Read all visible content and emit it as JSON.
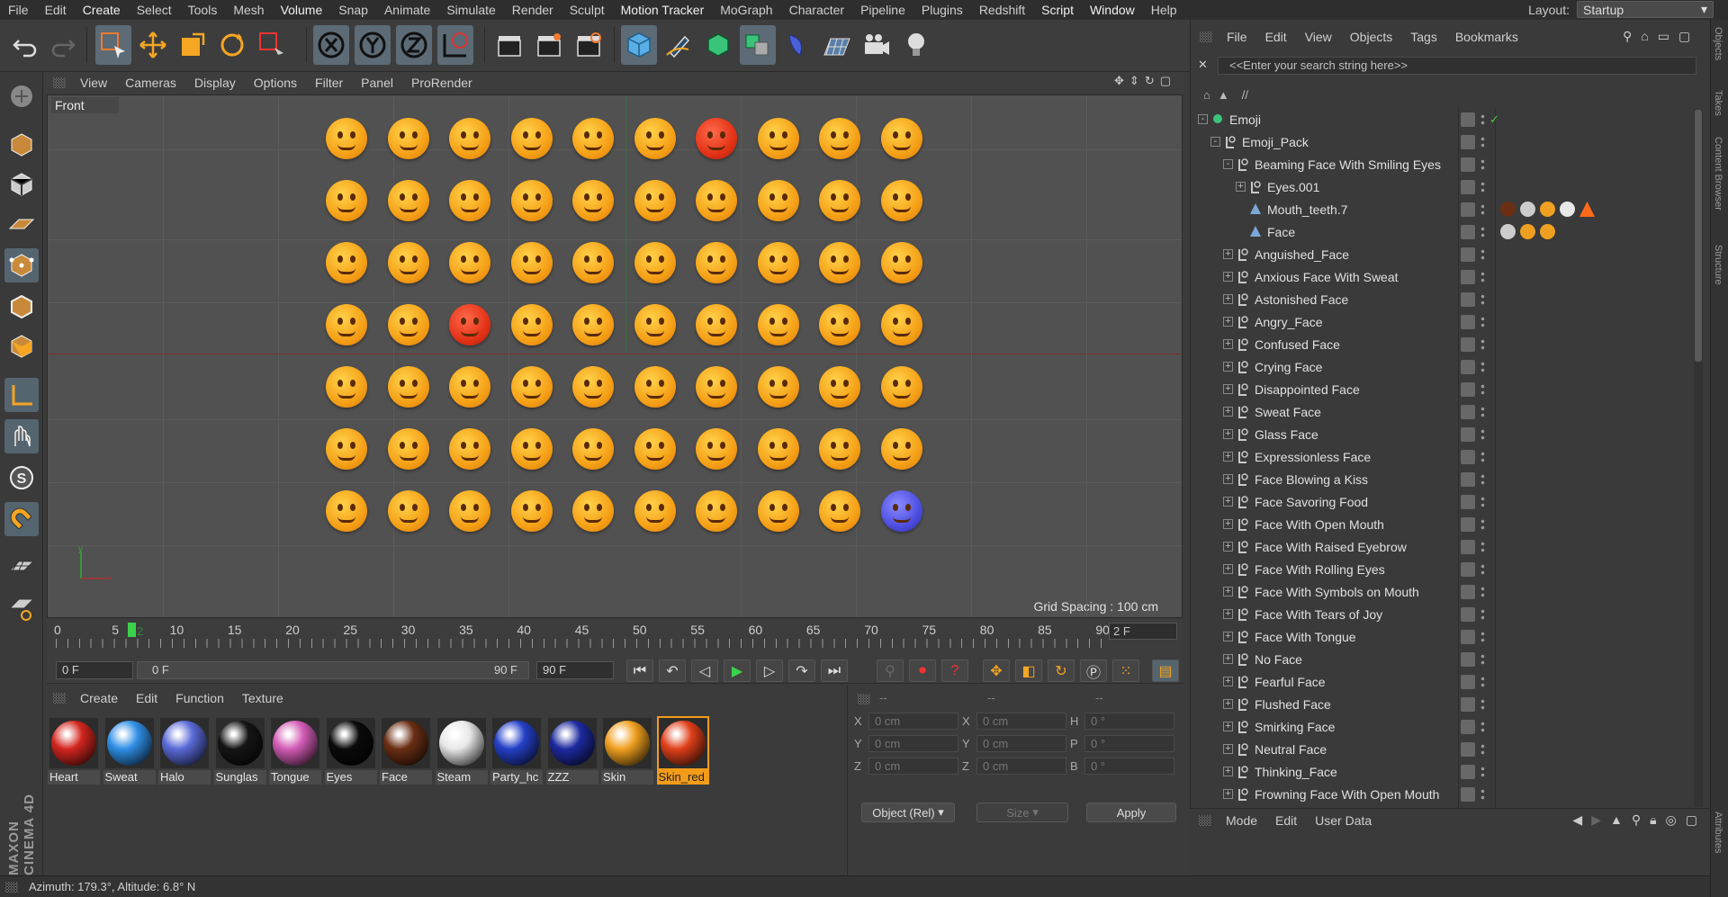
{
  "menubar": {
    "items": [
      "File",
      "Edit",
      "Create",
      "Select",
      "Tools",
      "Mesh",
      "Volume",
      "Snap",
      "Animate",
      "Simulate",
      "Render",
      "Sculpt",
      "Motion Tracker",
      "MoGraph",
      "Character",
      "Pipeline",
      "Plugins",
      "Redshift",
      "Script",
      "Window",
      "Help"
    ],
    "layout_label": "Layout:",
    "layout_value": "Startup"
  },
  "viewport": {
    "menu": [
      "View",
      "Cameras",
      "Display",
      "Options",
      "Filter",
      "Panel",
      "ProRender"
    ],
    "label": "Front",
    "grid_spacing": "Grid Spacing : 100 cm",
    "emoji_rows": 7,
    "emoji_cols": 10
  },
  "timeline": {
    "ticks": [
      "0",
      "5",
      "10",
      "15",
      "20",
      "25",
      "30",
      "35",
      "40",
      "45",
      "50",
      "55",
      "60",
      "65",
      "70",
      "75",
      "80",
      "85",
      "90"
    ],
    "current_frame_marker": "2",
    "end_frame_display": "2 F",
    "start_field": "0 F",
    "range_start": "0 F",
    "range_end": "90 F",
    "end_field": "90 F"
  },
  "materials": {
    "menu": [
      "Create",
      "Edit",
      "Function",
      "Texture"
    ],
    "items": [
      {
        "name": "Heart",
        "color": "#d3261f"
      },
      {
        "name": "Sweat",
        "color": "#2f8fe6"
      },
      {
        "name": "Halo",
        "color": "#5a6ad8"
      },
      {
        "name": "Sunglas",
        "color": "#151515"
      },
      {
        "name": "Tongue",
        "color": "#d25cb5"
      },
      {
        "name": "Eyes",
        "color": "#0a0a0a"
      },
      {
        "name": "Face",
        "color": "#6a2e14"
      },
      {
        "name": "Steam",
        "color": "#e8e8e8"
      },
      {
        "name": "Party_hc",
        "color": "#2440c8"
      },
      {
        "name": "ZZZ",
        "color": "#1d2aa0"
      },
      {
        "name": "Skin",
        "color": "#f0a020"
      },
      {
        "name": "Skin_red",
        "color": "#e0401a"
      }
    ]
  },
  "coords": {
    "header": [
      "--",
      "--",
      "--"
    ],
    "rows": [
      {
        "a": "X",
        "av": "0 cm",
        "b": "X",
        "bv": "0 cm",
        "c": "H",
        "cv": "0 °"
      },
      {
        "a": "Y",
        "av": "0 cm",
        "b": "Y",
        "bv": "0 cm",
        "c": "P",
        "cv": "0 °"
      },
      {
        "a": "Z",
        "av": "0 cm",
        "b": "Z",
        "bv": "0 cm",
        "c": "B",
        "cv": "0 °"
      }
    ],
    "mode": "Object (Rel)",
    "size": "Size",
    "apply": "Apply"
  },
  "objects": {
    "menu": [
      "File",
      "Edit",
      "View",
      "Objects",
      "Tags",
      "Bookmarks"
    ],
    "search_placeholder": "<<Enter your search string here>>",
    "path": "//",
    "tree": [
      {
        "name": "Emoji",
        "depth": 0,
        "exp": "-",
        "icon": "null-green"
      },
      {
        "name": "Emoji_Pack",
        "depth": 1,
        "exp": "-",
        "icon": "null"
      },
      {
        "name": "Beaming Face With Smiling Eyes",
        "depth": 2,
        "exp": "-",
        "icon": "null"
      },
      {
        "name": "Eyes.001",
        "depth": 3,
        "exp": "+",
        "icon": "null"
      },
      {
        "name": "Mouth_teeth.7",
        "depth": 3,
        "exp": "",
        "icon": "poly",
        "tags": [
          "#6a2e14",
          "#cccccc",
          "#f0a020",
          "#e8e8e8",
          "#ff6a1a"
        ]
      },
      {
        "name": "Face",
        "depth": 3,
        "exp": "",
        "icon": "poly",
        "tags": [
          "#cccccc",
          "#f0a020",
          "#f0a020"
        ]
      },
      {
        "name": "Anguished_Face",
        "depth": 2,
        "exp": "+",
        "icon": "null"
      },
      {
        "name": "Anxious Face With Sweat",
        "depth": 2,
        "exp": "+",
        "icon": "null"
      },
      {
        "name": "Astonished Face",
        "depth": 2,
        "exp": "+",
        "icon": "null"
      },
      {
        "name": "Angry_Face",
        "depth": 2,
        "exp": "+",
        "icon": "null"
      },
      {
        "name": "Confused Face",
        "depth": 2,
        "exp": "+",
        "icon": "null"
      },
      {
        "name": "Crying Face",
        "depth": 2,
        "exp": "+",
        "icon": "null"
      },
      {
        "name": "Disappointed Face",
        "depth": 2,
        "exp": "+",
        "icon": "null"
      },
      {
        "name": "Sweat Face",
        "depth": 2,
        "exp": "+",
        "icon": "null"
      },
      {
        "name": "Glass Face",
        "depth": 2,
        "exp": "+",
        "icon": "null"
      },
      {
        "name": "Expressionless Face",
        "depth": 2,
        "exp": "+",
        "icon": "null"
      },
      {
        "name": "Face Blowing a Kiss",
        "depth": 2,
        "exp": "+",
        "icon": "null"
      },
      {
        "name": "Face Savoring Food",
        "depth": 2,
        "exp": "+",
        "icon": "null"
      },
      {
        "name": "Face With Open Mouth",
        "depth": 2,
        "exp": "+",
        "icon": "null"
      },
      {
        "name": "Face With Raised Eyebrow",
        "depth": 2,
        "exp": "+",
        "icon": "null"
      },
      {
        "name": "Face With Rolling Eyes",
        "depth": 2,
        "exp": "+",
        "icon": "null"
      },
      {
        "name": "Face With Symbols on Mouth",
        "depth": 2,
        "exp": "+",
        "icon": "null"
      },
      {
        "name": "Face With Tears of Joy",
        "depth": 2,
        "exp": "+",
        "icon": "null"
      },
      {
        "name": "Face With Tongue",
        "depth": 2,
        "exp": "+",
        "icon": "null"
      },
      {
        "name": "No Face",
        "depth": 2,
        "exp": "+",
        "icon": "null"
      },
      {
        "name": "Fearful Face",
        "depth": 2,
        "exp": "+",
        "icon": "null"
      },
      {
        "name": "Flushed Face",
        "depth": 2,
        "exp": "+",
        "icon": "null"
      },
      {
        "name": "Smirking Face",
        "depth": 2,
        "exp": "+",
        "icon": "null"
      },
      {
        "name": "Neutral Face",
        "depth": 2,
        "exp": "+",
        "icon": "null"
      },
      {
        "name": "Thinking_Face",
        "depth": 2,
        "exp": "+",
        "icon": "null"
      },
      {
        "name": "Frowning Face With Open Mouth",
        "depth": 2,
        "exp": "+",
        "icon": "null"
      }
    ]
  },
  "attributes": {
    "menu": [
      "Mode",
      "Edit",
      "User Data"
    ]
  },
  "sidebar_tabs": [
    "Objects",
    "Takes",
    "Content Browser",
    "Structure",
    "Attributes"
  ],
  "status": "Azimuth: 179.3°, Altitude: 6.8°  N",
  "logo": "MAXON CINEMA 4D"
}
